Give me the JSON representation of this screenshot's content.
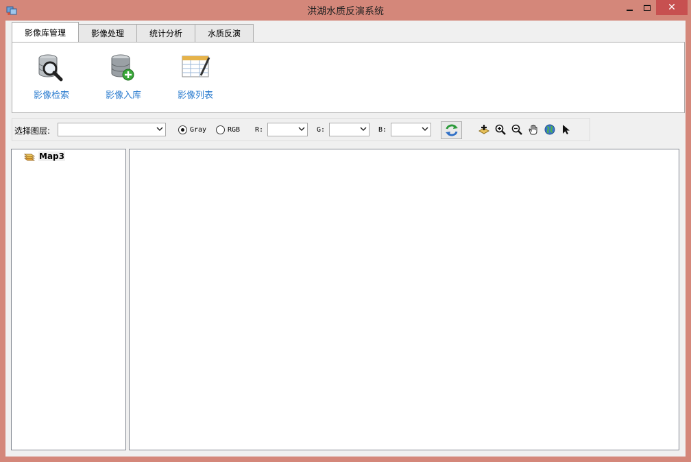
{
  "window": {
    "title": "洪湖水质反演系统",
    "close_glyph": "✕"
  },
  "tabs": [
    {
      "label": "影像库管理",
      "active": true
    },
    {
      "label": "影像处理",
      "active": false
    },
    {
      "label": "统计分析",
      "active": false
    },
    {
      "label": "水质反演",
      "active": false
    }
  ],
  "ribbon": {
    "buttons": [
      {
        "label": "影像检索",
        "icon": "database-search-icon"
      },
      {
        "label": "影像入库",
        "icon": "database-add-icon"
      },
      {
        "label": "影像列表",
        "icon": "table-list-icon"
      }
    ]
  },
  "toolbar": {
    "layer_label": "选择图层:",
    "layer_value": "",
    "mode_gray_label": "Gray",
    "mode_rgb_label": "RGB",
    "mode_selected": "Gray",
    "r_label": "R:",
    "g_label": "G:",
    "b_label": "B:",
    "r_value": "",
    "g_value": "",
    "b_value": "",
    "tools": [
      "add-data-icon",
      "zoom-in-icon",
      "zoom-out-icon",
      "pan-hand-icon",
      "full-extent-globe-icon",
      "select-pointer-icon"
    ]
  },
  "tree": {
    "items": [
      {
        "label": "Map3",
        "icon": "layers-icon"
      }
    ]
  },
  "colors": {
    "frame": "#d4877a",
    "close_button": "#c75050",
    "ribbon_label": "#2b7ccf",
    "client_bg": "#f0f0f0"
  }
}
